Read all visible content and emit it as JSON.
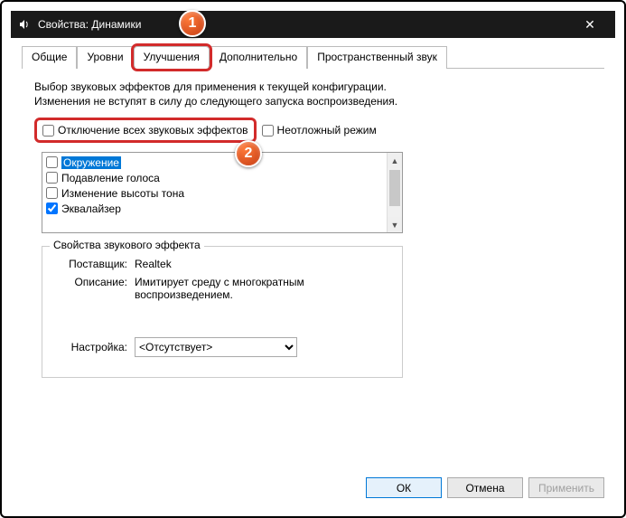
{
  "window": {
    "title": "Свойства: Динамики",
    "close_glyph": "✕"
  },
  "tabs": {
    "t0": "Общие",
    "t1": "Уровни",
    "t2": "Улучшения",
    "t3": "Дополнительно",
    "t4": "Пространственный звук"
  },
  "description": "Выбор звуковых эффектов для применения к текущей конфигурации. Изменения не вступят в силу до следующего запуска воспроизведения.",
  "checks": {
    "disable_all": "Отключение всех звуковых эффектов",
    "urgent": "Неотложный режим"
  },
  "effects": {
    "i0": "Окружение",
    "i1": "Подавление голоса",
    "i2": "Изменение высоты тона",
    "i3": "Эквалайзер"
  },
  "group": {
    "legend": "Свойства звукового эффекта",
    "provider_label": "Поставщик:",
    "provider_value": "Realtek",
    "desc_label": "Описание:",
    "desc_value": "Имитирует среду с многократным воспроизведением.",
    "setting_label": "Настройка:",
    "setting_value": "<Отсутствует>"
  },
  "footer": {
    "ok": "ОК",
    "cancel": "Отмена",
    "apply": "Применить"
  },
  "badges": {
    "b1": "1",
    "b2": "2"
  }
}
